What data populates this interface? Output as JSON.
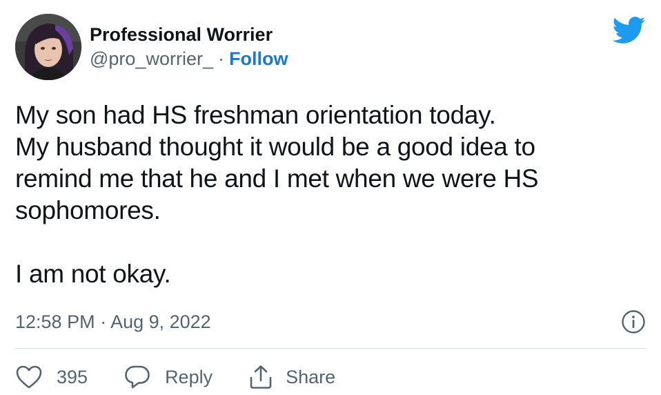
{
  "author": {
    "display_name": "Professional Worrier",
    "handle": "@pro_worrier_",
    "separator": "·",
    "follow_label": "Follow"
  },
  "brand": {
    "icon": "twitter-bird-icon",
    "color": "#1d9bf0"
  },
  "tweet": {
    "lines": [
      "My son had HS freshman orientation today.",
      "My husband thought it would be a good idea to",
      "remind me that he and I met when we were HS",
      "sophomores."
    ],
    "closing": "I am not okay."
  },
  "meta": {
    "timestamp": "12:58 PM · Aug 9, 2022",
    "info_icon": "info-icon"
  },
  "actions": {
    "like_count": "395",
    "like_icon": "heart-icon",
    "reply_label": "Reply",
    "reply_icon": "speech-bubble-icon",
    "share_label": "Share",
    "share_icon": "share-upload-icon"
  },
  "colors": {
    "text": "#0f1419",
    "secondary": "#536471",
    "link": "#1d77d1",
    "divider": "#cfd9de"
  }
}
